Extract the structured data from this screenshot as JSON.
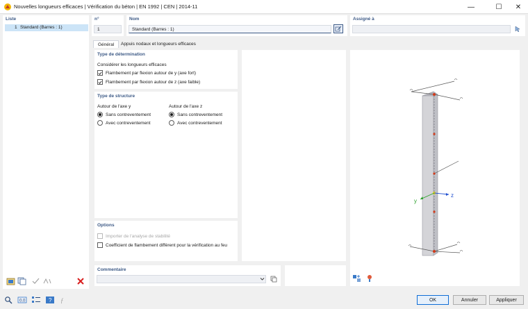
{
  "window": {
    "title": "Nouvelles longueurs efficaces | Vérification du béton | EN 1992 | CEN | 2014-11",
    "minimize": "—",
    "maximize": "☐",
    "close": "✕"
  },
  "list": {
    "header": "Liste",
    "items": [
      {
        "number": "1",
        "label": "Standard (Barres : 1)"
      }
    ]
  },
  "header_fields": {
    "number_label": "n°",
    "number_value": "1",
    "name_label": "Nom",
    "name_value": "Standard (Barres : 1)",
    "assigned_label": "Assigné à",
    "assigned_value": ""
  },
  "tabs": [
    {
      "label": "Général",
      "active": true
    },
    {
      "label": "Appuis nodaux et longueurs efficaces",
      "active": false
    }
  ],
  "determination": {
    "title": "Type de détermination",
    "subtitle": "Considérer les longueurs efficaces",
    "options": [
      {
        "label": "Flambement par flexion autour de y (axe fort)",
        "checked": true
      },
      {
        "label": "Flambement par flexion autour de z (axe faible)",
        "checked": true
      }
    ]
  },
  "structure": {
    "title": "Type de structure",
    "axis_y": {
      "label": "Autour de l'axe y",
      "options": [
        {
          "label": "Sans contreventement",
          "selected": true
        },
        {
          "label": "Avec contreventement",
          "selected": false
        }
      ]
    },
    "axis_z": {
      "label": "Autour de l'axe z",
      "options": [
        {
          "label": "Sans contreventement",
          "selected": true
        },
        {
          "label": "Avec contreventement",
          "selected": false
        }
      ]
    }
  },
  "options_group": {
    "title": "Options",
    "items": [
      {
        "label": "Importer de l'analyse de stabilité",
        "checked": false,
        "disabled": true
      },
      {
        "label": "Coefficient de flambement différent pour la vérification au feu",
        "checked": false,
        "disabled": false
      }
    ]
  },
  "comment": {
    "label": "Commentaire",
    "value": ""
  },
  "preview": {
    "axis_y_label": "y",
    "axis_z_label": "z"
  },
  "footer": {
    "ok": "OK",
    "cancel": "Annuler",
    "apply": "Appliquer"
  },
  "colors": {
    "accent": "#3d5a86",
    "selection": "#cce4f7",
    "node_red": "#d23a1a",
    "axis_green": "#2aa02a",
    "axis_blue": "#1f4fd0",
    "delete_red": "#d81e1e"
  }
}
